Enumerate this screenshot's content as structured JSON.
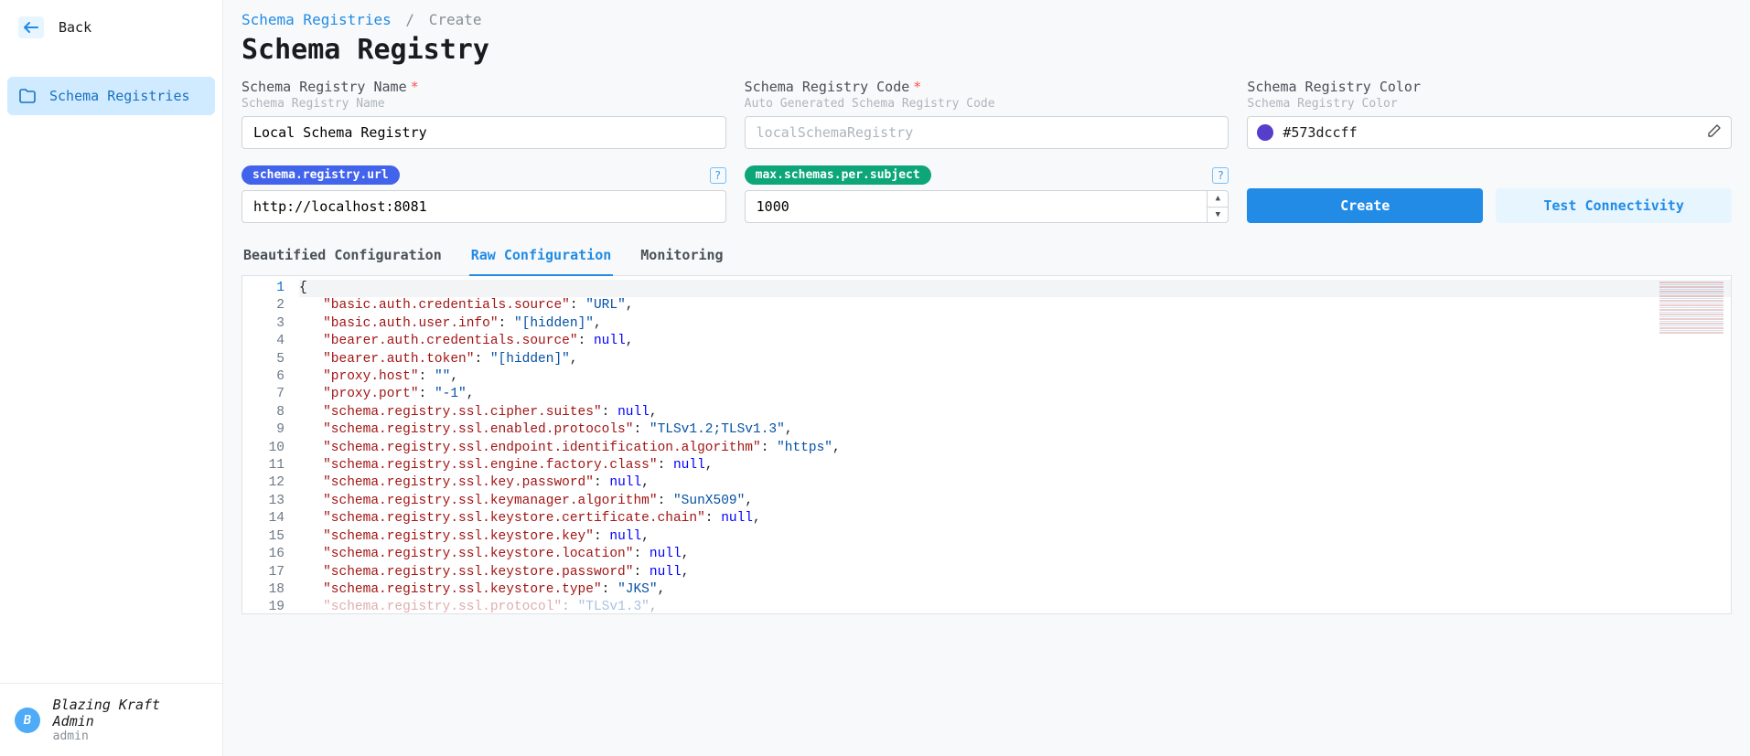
{
  "sidebar": {
    "back_label": "Back",
    "nav_item_label": "Schema Registries"
  },
  "user": {
    "avatar_letter": "B",
    "name": "Blazing Kraft Admin",
    "role": "admin"
  },
  "breadcrumb": {
    "root": "Schema Registries",
    "sep": "/",
    "current": "Create"
  },
  "page_title": "Schema Registry",
  "fields": {
    "name": {
      "label": "Schema Registry Name",
      "sub": "Schema Registry Name",
      "value": "Local Schema Registry"
    },
    "code": {
      "label": "Schema Registry Code",
      "sub": "Auto Generated Schema Registry Code",
      "value": "localSchemaRegistry"
    },
    "color": {
      "label": "Schema Registry Color",
      "sub": "Schema Registry Color",
      "value": "#573dccff"
    }
  },
  "config": {
    "url_pill": "schema.registry.url",
    "url_value": "http://localhost:8081",
    "max_pill": "max.schemas.per.subject",
    "max_value": "1000",
    "help": "?"
  },
  "buttons": {
    "create": "Create",
    "test": "Test Connectivity"
  },
  "tabs": {
    "beautified": "Beautified Configuration",
    "raw": "Raw Configuration",
    "monitoring": "Monitoring"
  },
  "editor": {
    "lines": [
      {
        "n": 1,
        "t": "brace",
        "s": "{"
      },
      {
        "n": 2,
        "k": "basic.auth.credentials.source",
        "vt": "str",
        "v": "URL"
      },
      {
        "n": 3,
        "k": "basic.auth.user.info",
        "vt": "str",
        "v": "[hidden]"
      },
      {
        "n": 4,
        "k": "bearer.auth.credentials.source",
        "vt": "null",
        "v": "null"
      },
      {
        "n": 5,
        "k": "bearer.auth.token",
        "vt": "str",
        "v": "[hidden]"
      },
      {
        "n": 6,
        "k": "proxy.host",
        "vt": "str",
        "v": ""
      },
      {
        "n": 7,
        "k": "proxy.port",
        "vt": "str",
        "v": "-1"
      },
      {
        "n": 8,
        "k": "schema.registry.ssl.cipher.suites",
        "vt": "null",
        "v": "null"
      },
      {
        "n": 9,
        "k": "schema.registry.ssl.enabled.protocols",
        "vt": "str",
        "v": "TLSv1.2;TLSv1.3"
      },
      {
        "n": 10,
        "k": "schema.registry.ssl.endpoint.identification.algorithm",
        "vt": "str",
        "v": "https"
      },
      {
        "n": 11,
        "k": "schema.registry.ssl.engine.factory.class",
        "vt": "null",
        "v": "null"
      },
      {
        "n": 12,
        "k": "schema.registry.ssl.key.password",
        "vt": "null",
        "v": "null"
      },
      {
        "n": 13,
        "k": "schema.registry.ssl.keymanager.algorithm",
        "vt": "str",
        "v": "SunX509"
      },
      {
        "n": 14,
        "k": "schema.registry.ssl.keystore.certificate.chain",
        "vt": "null",
        "v": "null"
      },
      {
        "n": 15,
        "k": "schema.registry.ssl.keystore.key",
        "vt": "null",
        "v": "null"
      },
      {
        "n": 16,
        "k": "schema.registry.ssl.keystore.location",
        "vt": "null",
        "v": "null"
      },
      {
        "n": 17,
        "k": "schema.registry.ssl.keystore.password",
        "vt": "null",
        "v": "null"
      },
      {
        "n": 18,
        "k": "schema.registry.ssl.keystore.type",
        "vt": "str",
        "v": "JKS"
      },
      {
        "n": 19,
        "k": "schema.registry.ssl.protocol",
        "vt": "str",
        "v": "TLSv1.3",
        "faded": true
      }
    ]
  }
}
